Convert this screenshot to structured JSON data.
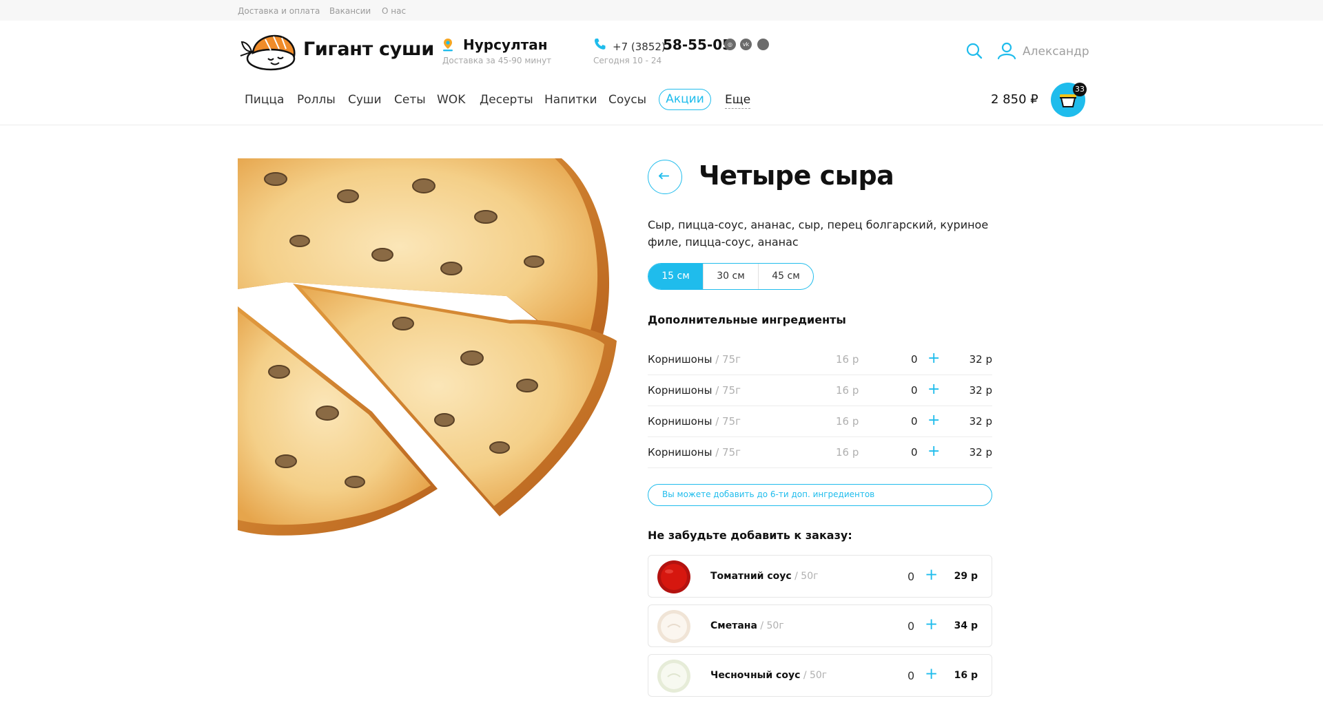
{
  "top_links": [
    "Доставка и оплата",
    "Вакансии",
    "О нас"
  ],
  "brand": {
    "name": "Гигант суши"
  },
  "location": {
    "city": "Нурсултан",
    "delivery_time": "Доставка за 45-90 минут"
  },
  "contact": {
    "phone_code": "+7 (3852)",
    "phone_number": "58-55-05",
    "hours": "Сегодня 10 - 24",
    "socials": [
      "instagram-icon",
      "vk-icon",
      "social-icon"
    ]
  },
  "user": {
    "name": "Александр"
  },
  "nav": {
    "items": [
      "Пицца",
      "Роллы",
      "Суши",
      "Сеты",
      "WOK",
      "Десерты",
      "Напитки",
      "Соусы"
    ],
    "promo": "Акции",
    "more": "Еще"
  },
  "cart": {
    "total": "2 850 ₽",
    "count": "33"
  },
  "product": {
    "title": "Четыре сыра",
    "description": "Сыр, пицца-соус, ананас, сыр, перец болгарский, куриное филе, пицца-соус, ананас",
    "sizes": [
      "15 см",
      "30 см",
      "45 см"
    ],
    "selected_size": "15 см"
  },
  "extras": {
    "title": "Дополнительные ингредиенты",
    "rows": [
      {
        "name": "Корнишоны",
        "weight": " / 75г",
        "price": "16 р",
        "qty": "0",
        "total": "32 р"
      },
      {
        "name": "Корнишоны",
        "weight": " / 75г",
        "price": "16 р",
        "qty": "0",
        "total": "32 р"
      },
      {
        "name": "Корнишоны",
        "weight": " / 75г",
        "price": "16 р",
        "qty": "0",
        "total": "32 р"
      },
      {
        "name": "Корнишоны",
        "weight": " / 75г",
        "price": "16 р",
        "qty": "0",
        "total": "32 р"
      }
    ],
    "limit_note": "Вы можете добавить до 6-ти доп. ингредиентов"
  },
  "upsell": {
    "title": "Не забудьте добавить к заказу:",
    "items": [
      {
        "name": "Томатний соус",
        "weight": " / 50г",
        "qty": "0",
        "price": "29 р"
      },
      {
        "name": "Сметана",
        "weight": " / 50г",
        "qty": "0",
        "price": "34 р"
      },
      {
        "name": "Чесночный соус",
        "weight": " / 50г",
        "qty": "0",
        "price": "16 р"
      }
    ]
  },
  "colors": {
    "accent": "#1fbcec",
    "logo_orange": "#f08c2a",
    "pin_orange": "#f5a623"
  }
}
